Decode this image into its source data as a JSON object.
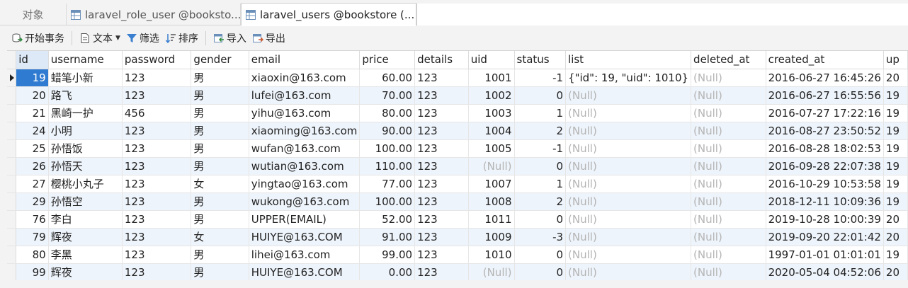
{
  "tabs": [
    {
      "label": "对象",
      "active": false
    },
    {
      "label": "laravel_role_user @booksto...",
      "active": false,
      "icon": "table-icon"
    },
    {
      "label": "laravel_users @bookstore (...",
      "active": true,
      "icon": "table-icon"
    }
  ],
  "toolbar": {
    "begin_transaction": "开始事务",
    "text": "文本",
    "filter": "筛选",
    "sort": "排序",
    "import": "导入",
    "export": "导出"
  },
  "columns": [
    "id",
    "username",
    "password",
    "gender",
    "email",
    "price",
    "details",
    "uid",
    "status",
    "list",
    "deleted_at",
    "created_at",
    "up"
  ],
  "rows": [
    {
      "id": "19",
      "username": "蜡笔小新",
      "password": "123",
      "gender": "男",
      "email": "xiaoxin@163.com",
      "price": "60.00",
      "details": "123",
      "uid": "1001",
      "status": "-1",
      "list": "{\"id\": 19, \"uid\": 1010}",
      "deleted_at": "(Null)",
      "created_at": "2016-06-27 16:45:26",
      "up": "20"
    },
    {
      "id": "20",
      "username": "路飞",
      "password": "123",
      "gender": "男",
      "email": "lufei@163.com",
      "price": "70.00",
      "details": "123",
      "uid": "1002",
      "status": "0",
      "list": "(Null)",
      "deleted_at": "(Null)",
      "created_at": "2016-06-27 16:55:56",
      "up": "19"
    },
    {
      "id": "21",
      "username": "黑崎一护",
      "password": "456",
      "gender": "男",
      "email": "yihu@163.com",
      "price": "80.00",
      "details": "123",
      "uid": "1003",
      "status": "1",
      "list": "(Null)",
      "deleted_at": "(Null)",
      "created_at": "2016-07-27 17:22:16",
      "up": "19"
    },
    {
      "id": "24",
      "username": "小明",
      "password": "123",
      "gender": "男",
      "email": "xiaoming@163.com",
      "price": "90.00",
      "details": "123",
      "uid": "1004",
      "status": "2",
      "list": "(Null)",
      "deleted_at": "(Null)",
      "created_at": "2016-08-27 23:50:52",
      "up": "19"
    },
    {
      "id": "25",
      "username": "孙悟饭",
      "password": "123",
      "gender": "男",
      "email": "wufan@163.com",
      "price": "100.00",
      "details": "123",
      "uid": "1005",
      "status": "-1",
      "list": "(Null)",
      "deleted_at": "(Null)",
      "created_at": "2016-08-28 18:02:53",
      "up": "19"
    },
    {
      "id": "26",
      "username": "孙悟天",
      "password": "123",
      "gender": "男",
      "email": "wutian@163.com",
      "price": "110.00",
      "details": "123",
      "uid": "(Null)",
      "status": "0",
      "list": "(Null)",
      "deleted_at": "(Null)",
      "created_at": "2016-09-28 22:07:38",
      "up": "19"
    },
    {
      "id": "27",
      "username": "樱桃小丸子",
      "password": "123",
      "gender": "女",
      "email": "yingtao@163.com",
      "price": "77.00",
      "details": "123",
      "uid": "1007",
      "status": "1",
      "list": "(Null)",
      "deleted_at": "(Null)",
      "created_at": "2016-10-29 10:53:58",
      "up": "19"
    },
    {
      "id": "29",
      "username": "孙悟空",
      "password": "123",
      "gender": "男",
      "email": "wukong@163.com",
      "price": "100.00",
      "details": "123",
      "uid": "1008",
      "status": "2",
      "list": "(Null)",
      "deleted_at": "(Null)",
      "created_at": "2018-12-11 10:09:36",
      "up": "19"
    },
    {
      "id": "76",
      "username": "李白",
      "password": "123",
      "gender": "男",
      "email": "UPPER(EMAIL)",
      "price": "52.00",
      "details": "123",
      "uid": "1011",
      "status": "0",
      "list": "(Null)",
      "deleted_at": "(Null)",
      "created_at": "2019-10-28 10:00:39",
      "up": "20"
    },
    {
      "id": "79",
      "username": "辉夜",
      "password": "123",
      "gender": "女",
      "email": "HUIYE@163.COM",
      "price": "91.00",
      "details": "123",
      "uid": "1009",
      "status": "-3",
      "list": "(Null)",
      "deleted_at": "(Null)",
      "created_at": "2019-09-20 22:01:42",
      "up": "20"
    },
    {
      "id": "80",
      "username": "李黑",
      "password": "123",
      "gender": "男",
      "email": "lihei@163.com",
      "price": "99.00",
      "details": "123",
      "uid": "1010",
      "status": "0",
      "list": "(Null)",
      "deleted_at": "(Null)",
      "created_at": "1997-01-01 01:01:01",
      "up": "19"
    },
    {
      "id": "99",
      "username": "辉夜",
      "password": "123",
      "gender": "男",
      "email": "HUIYE@163.COM",
      "price": "0.00",
      "details": "123",
      "uid": "(Null)",
      "status": "0",
      "list": "(Null)",
      "deleted_at": "(Null)",
      "created_at": "2020-05-04 04:52:06",
      "up": "20"
    }
  ],
  "selected_row": 0,
  "colors": {
    "selection": "#2f7bd1",
    "alt_row": "#eef4fb",
    "null_text": "#b4b4b4"
  }
}
